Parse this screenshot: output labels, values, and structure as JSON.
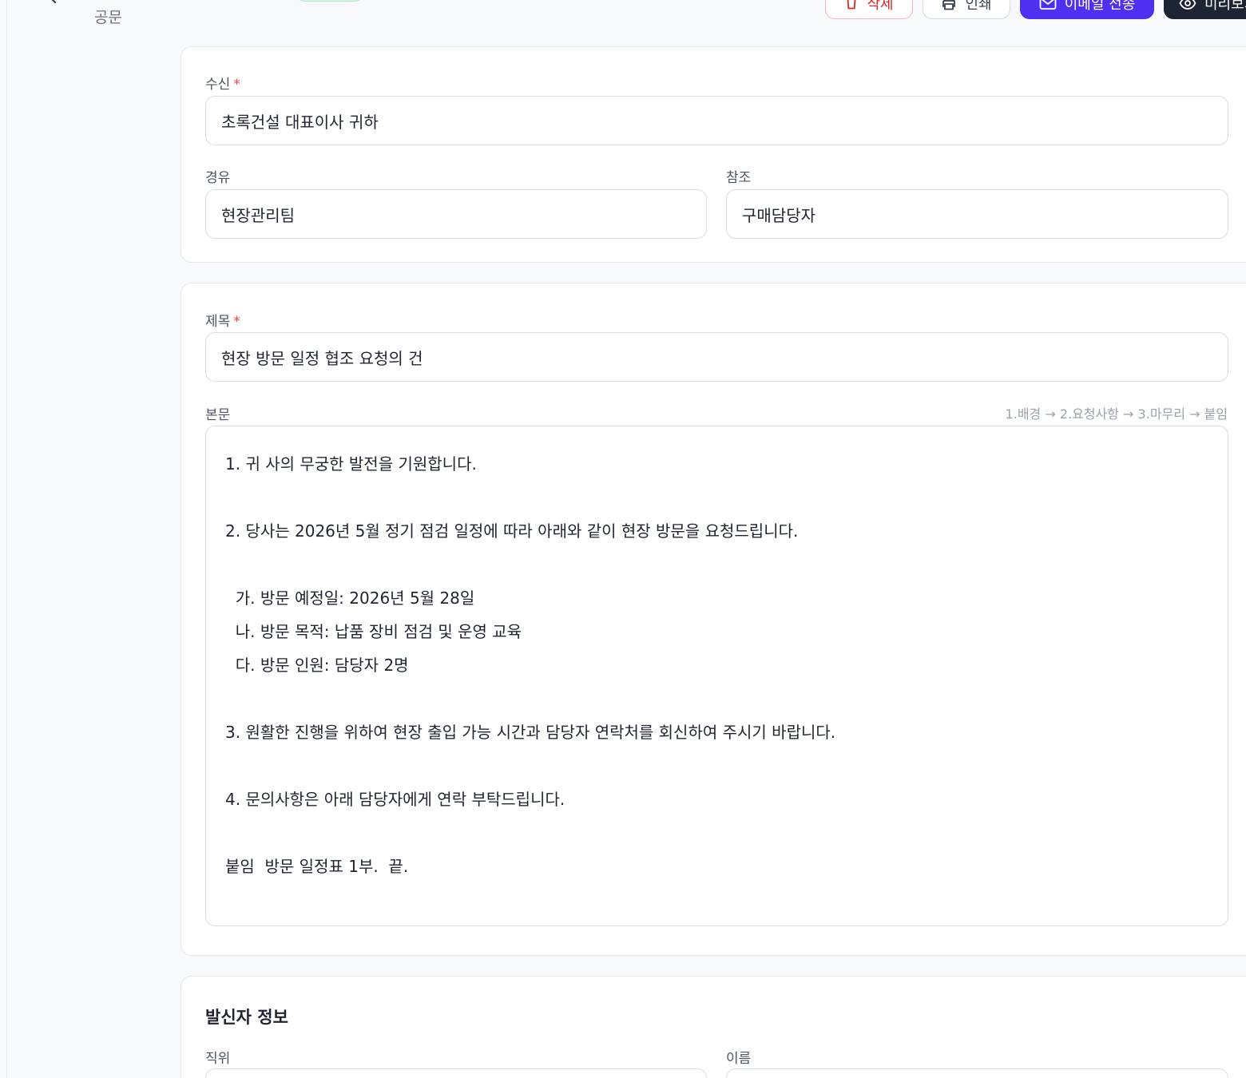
{
  "header": {
    "doc_type": "공문",
    "actions": {
      "delete": "삭제",
      "print": "인쇄",
      "email": "이메일 전송",
      "preview": "미리보기"
    }
  },
  "recipient": {
    "label": "수신",
    "required_mark": "*",
    "value": "초록건설 대표이사 귀하"
  },
  "via": {
    "label": "경유",
    "value": "현장관리팀"
  },
  "reference": {
    "label": "참조",
    "value": "구매담당자"
  },
  "subject": {
    "label": "제목",
    "required_mark": "*",
    "value": "현장 방문 일정 협조 요청의 건"
  },
  "body": {
    "label": "본문",
    "hint": "1.배경 → 2.요청사항 → 3.마무리 → 붙임",
    "lines": [
      "1. 귀 사의 무궁한 발전을 기원합니다.",
      "",
      "2. 당사는 2026년 5월 정기 점검 일정에 따라 아래와 같이 현장 방문을 요청드립니다.",
      "",
      "  가. 방문 예정일: 2026년 5월 28일",
      "  나. 방문 목적: 납품 장비 점검 및 운영 교육",
      "  다. 방문 인원: 담당자 2명",
      "",
      "3. 원활한 진행을 위하여 현장 출입 가능 시간과 담당자 연락처를 회신하여 주시기 바랍니다.",
      "",
      "4. 문의사항은 아래 담당자에게 연락 부탁드립니다.",
      "",
      "붙임  방문 일정표 1부.  끝."
    ]
  },
  "sender": {
    "title": "발신자 정보",
    "position_label": "직위",
    "name_label": "이름"
  },
  "colors": {
    "accent": "#4f2ff0",
    "danger": "#dc2626",
    "dark_button": "#1d2433",
    "required": "#e5484d"
  }
}
